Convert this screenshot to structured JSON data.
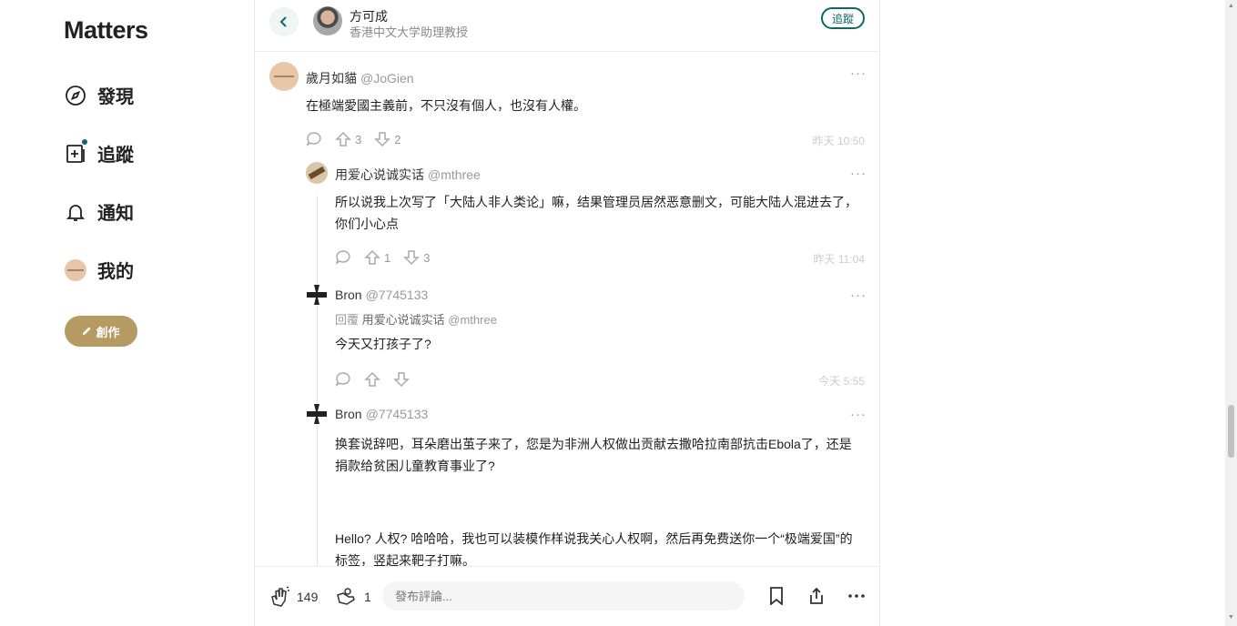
{
  "sidebar": {
    "logo": "Matters",
    "nav": [
      {
        "label": "發現",
        "icon": "compass-icon"
      },
      {
        "label": "追蹤",
        "icon": "follow-feed-icon"
      },
      {
        "label": "通知",
        "icon": "bell-icon"
      },
      {
        "label": "我的",
        "icon": "avatar"
      }
    ],
    "create_label": "創作"
  },
  "header": {
    "author_name": "方可成",
    "author_desc": "香港中文大学助理教授",
    "follow_label": "追蹤"
  },
  "comments": [
    {
      "name": "歲月如貓",
      "handle": "@JoGien",
      "text": "在極端愛國主義前，不只沒有個人，也沒有人權。",
      "upvotes": "3",
      "downvotes": "2",
      "time": "昨天 10:50"
    },
    {
      "name": "用爱心说诚实话",
      "handle": "@mthree",
      "text": "所以说我上次写了「大陆人非人类论」嘛，结果管理员居然恶意删文，可能大陆人混进去了，你们小心点",
      "upvotes": "1",
      "downvotes": "3",
      "time": "昨天 11:04"
    },
    {
      "name": "Bron",
      "handle": "@7745133",
      "reply_prefix": "回覆",
      "reply_to_name": "用爱心说诚实话",
      "reply_to_handle": "@mthree",
      "text": "今天又打孩子了?",
      "time": "今天 5:55"
    },
    {
      "name": "Bron",
      "handle": "@7745133",
      "text": "换套说辞吧，耳朵磨出茧子来了，您是为非洲人权做出贡献去撒哈拉南部抗击Ebola了，还是捐款给贫困儿童教育事业了?",
      "text2": "Hello?  人权? 哈哈哈，我也可以装模作样说我关心人权啊，然后再免费送你一个“极端爱国”的标签，竖起来靶子打嘛。"
    }
  ],
  "bottom": {
    "clap_count": "149",
    "donate_count": "1",
    "comment_placeholder": "發布評論..."
  }
}
